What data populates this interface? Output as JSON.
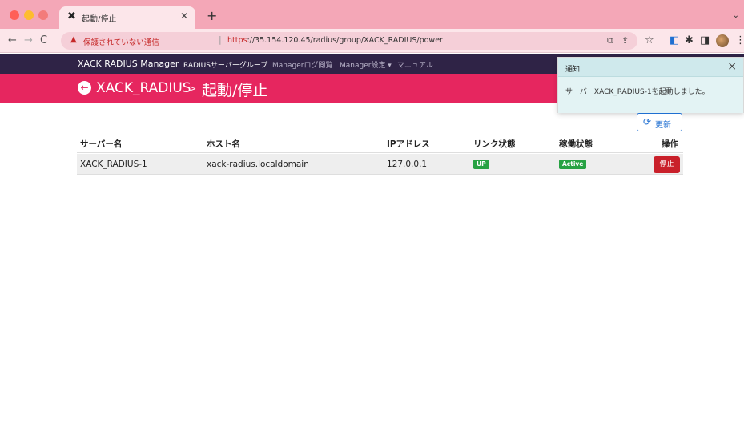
{
  "browser": {
    "tab_title": "起動/停止",
    "tab_favicon": "✖",
    "security_warning": "保護されていない通信",
    "url_scheme": "https",
    "url_rest": "://35.154.120.45/radius/group/XACK_RADIUS/power"
  },
  "appnav": {
    "brand": "XACK RADIUS Manager",
    "links": [
      {
        "label": "RADIUSサーバーグループ"
      },
      {
        "label": "Managerログ閲覧"
      },
      {
        "label": "Manager設定 ▾"
      },
      {
        "label": "マニュアル"
      }
    ]
  },
  "header": {
    "group_name": "XACK_RADIUS",
    "separator": ">",
    "page_title": "起動/停止"
  },
  "toast": {
    "title": "通知",
    "message": "サーバーXACK_RADIUS-1を起動しました。"
  },
  "refresh_label": "更新",
  "table": {
    "headers": [
      "サーバー名",
      "ホスト名",
      "IPアドレス",
      "リンク状態",
      "稼働状態",
      "操作"
    ],
    "rows": [
      {
        "server": "XACK_RADIUS-1",
        "host": "xack-radius.localdomain",
        "ip": "127.0.0.1",
        "link": "UP",
        "status": "Active",
        "action": "停止"
      }
    ]
  },
  "colors": {
    "header_bg": "#e6265f",
    "nav_bg": "#2f2346",
    "badge_green": "#27a243",
    "stop_red": "#c9202a",
    "primary_blue": "#1f6fd1"
  }
}
